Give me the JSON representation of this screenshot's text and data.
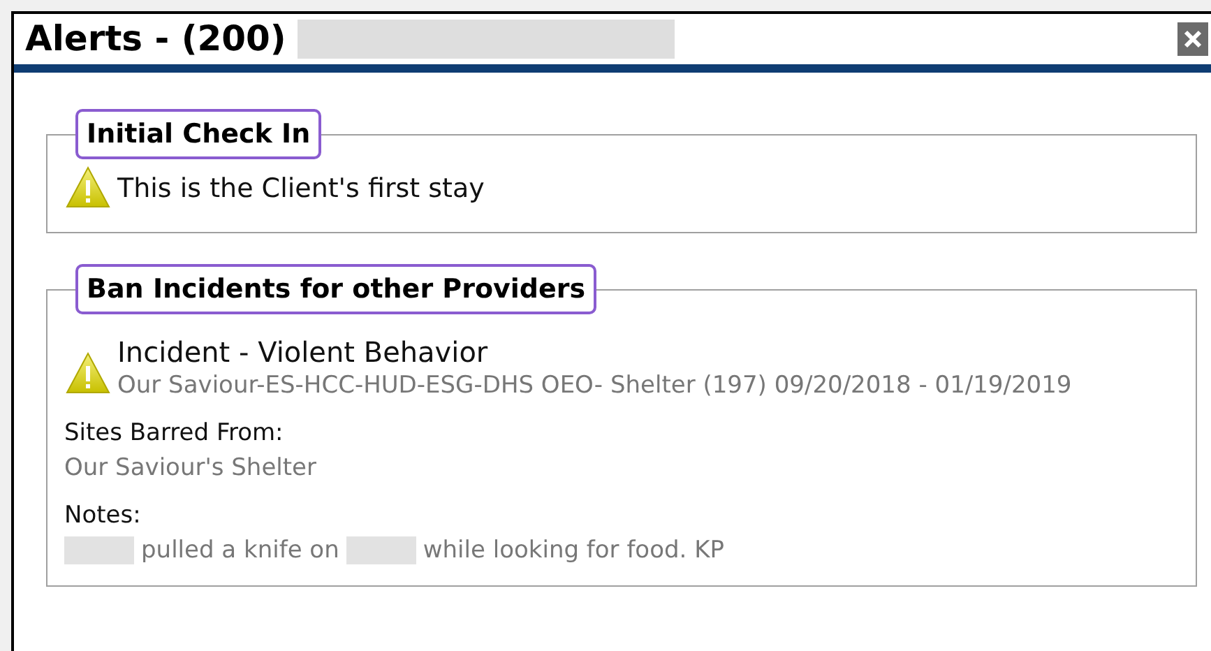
{
  "window": {
    "title": "Alerts - (200)",
    "title_redacted": true
  },
  "sections": [
    {
      "title": "Initial Check In",
      "items": [
        {
          "kind": "message",
          "text": "This is the Client's first stay"
        }
      ]
    },
    {
      "title": "Ban Incidents for other Providers",
      "items": [
        {
          "kind": "incident",
          "heading": "Incident - Violent Behavior",
          "detail": "Our Saviour-ES-HCC-HUD-ESG-DHS OEO- Shelter (197) 09/20/2018 - 01/19/2019"
        },
        {
          "kind": "field",
          "label": "Sites Barred From:",
          "segments": [
            {
              "kind": "text",
              "text": "Our Saviour's Shelter"
            }
          ]
        },
        {
          "kind": "field",
          "label": "Notes:",
          "segments": [
            {
              "kind": "redacted"
            },
            {
              "kind": "text",
              "text": "pulled a knife on"
            },
            {
              "kind": "redacted"
            },
            {
              "kind": "text",
              "text": "while looking for food. KP"
            }
          ]
        }
      ]
    }
  ]
}
